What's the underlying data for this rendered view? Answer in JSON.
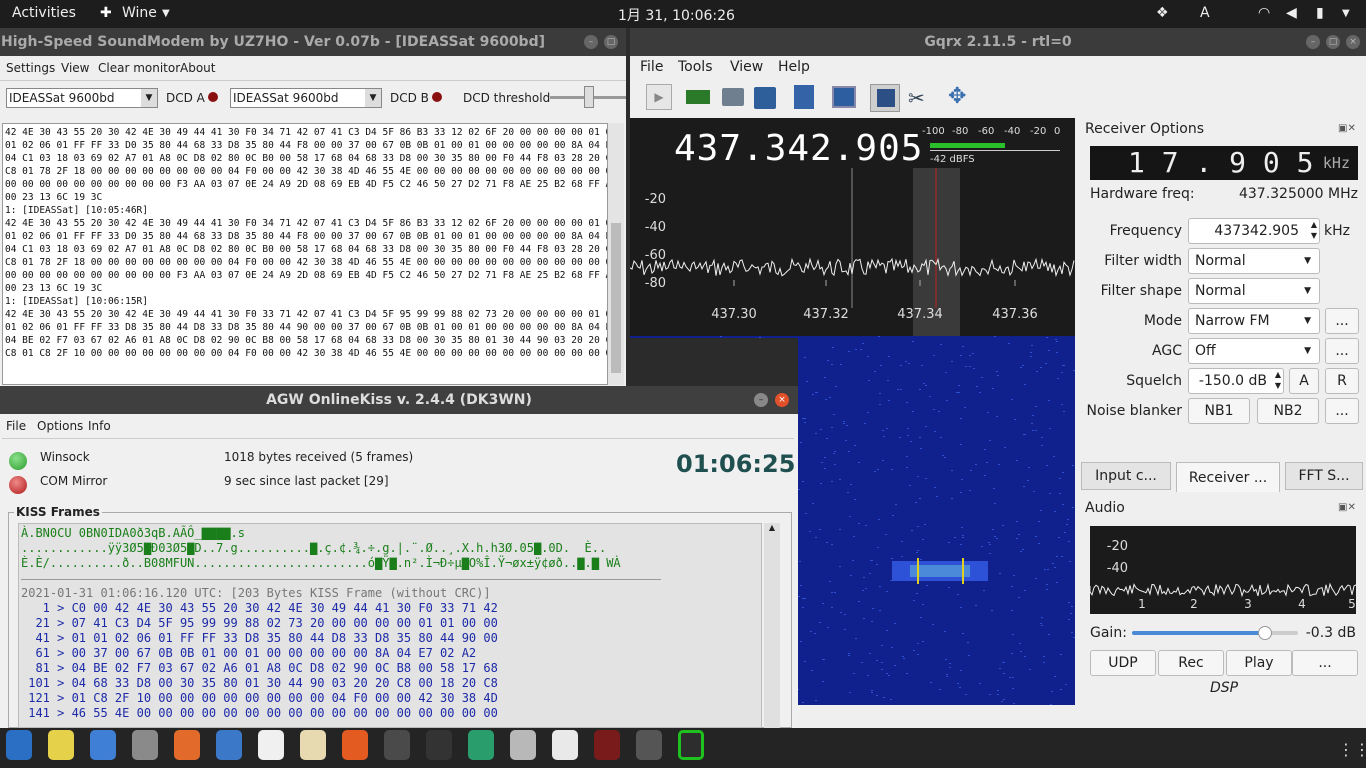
{
  "topbar": {
    "activities": "Activities",
    "app": "Wine",
    "clock": "1月 31, 10:06:26",
    "lang": "A"
  },
  "soundmodem": {
    "title": "High-Speed SoundModem by UZ7HO - Ver 0.07b - [IDEASSat 9600bd]",
    "menu": [
      "Settings",
      "View",
      "Clear monitor",
      "About"
    ],
    "mode_a": "IDEASSat 9600bd",
    "dcd_a": "DCD A",
    "mode_b": "IDEASSat 9600bd",
    "dcd_b": "DCD B",
    "dcd_threshold": "DCD threshold",
    "monitor": [
      "42 4E 30 43 55 20 30 42 4E 30 49 44 41 30 F0 34 71 42 07 41 C3 D4 5F 86 B3 33 12 02 6F 20 00 00 00 00 01 01 00 00 01",
      "01 02 06 01 FF FF 33 D0 35 80 44 68 33 D8 35 80 44 F8 00 00 37 00 67 0B 0B 01 00 01 00 00 00 00 00 8A 04 EA 02 B1",
      "04 C1 03 18 03 69 02 A7 01 A8 0C D8 02 80 0C B0 00 58 17 68 04 68 33 D8 00 30 35 80 00 F0 44 F8 03 28 20 C0 00 18 20",
      "C8 01 78 2F 18 00 00 00 00 00 00 00 00 04 F0 00 00 42 30 38 4D 46 55 4E 00 00 00 00 00 00 00 00 00 00 00 00 00 00 00",
      "00 00 00 00 00 00 00 00 00 00 F3 AA 03 07 0E 24 A9 2D 08 69 EB 4D F5 C2 46 50 27 D2 71 F8 AE 25 B2 68 FF A9 D8 F0 00",
      "00 23 13 6C 19 3C",
      "",
      "1: [IDEASSat] [10:05:46R]",
      "42 4E 30 43 55 20 30 42 4E 30 49 44 41 30 F0 34 71 42 07 41 C3 D4 5F 86 B3 33 12 02 6F 20 00 00 00 00 01 01 00 00 01",
      "01 02 06 01 FF FF 33 D0 35 80 44 68 33 D8 35 80 44 F8 00 00 37 00 67 0B 0B 01 00 01 00 00 00 00 00 8A 04 EA 02 B1",
      "04 C1 03 18 03 69 02 A7 01 A8 0C D8 02 80 0C B0 00 58 17 68 04 68 33 D8 00 30 35 80 00 F0 44 F8 03 28 20 C0 00 18 20",
      "C8 01 78 2F 18 00 00 00 00 00 00 00 00 04 F0 00 00 42 30 38 4D 46 55 4E 00 00 00 00 00 00 00 00 00 00 00 00 00 00 00",
      "00 00 00 00 00 00 00 00 00 00 F3 AA 03 07 0E 24 A9 2D 08 69 EB 4D F5 C2 46 50 27 D2 71 F8 AE 25 B2 68 FF A9 D8 F0 00",
      "00 23 13 6C 19 3C",
      "",
      "1: [IDEASSat] [10:06:15R]",
      "42 4E 30 43 55 20 30 42 4E 30 49 44 41 30 F0 33 71 42 07 41 C3 D4 5F 95 99 99 88 02 73 20 00 00 00 00 01 01 00 00 01",
      "01 02 06 01 FF FF 33 D8 35 80 44 D8 33 D8 35 80 44 90 00 00 37 00 67 0B 0B 01 00 01 00 00 00 00 00 8A 04 E7 02 A2",
      "04 BE 02 F7 03 67 02 A6 01 A8 0C D8 02 90 0C B8 00 58 17 68 04 68 33 D8 00 30 35 80 01 30 44 90 03 20 20 C8 00 18 20",
      "C8 01 C8 2F 10 00 00 00 00 00 00 00 00 04 F0 00 00 42 30 38 4D 46 55 4E 00 00 00 00 00 00 00 00 00 00 00 00 00 00 00"
    ]
  },
  "agw": {
    "title": "AGW OnlineKiss v. 2.4.4  (DK3WN)",
    "menu": [
      "File",
      "Options",
      "Info"
    ],
    "winsock": "Winsock",
    "winsock_status": "1018 bytes received (5 frames)",
    "com": "COM Mirror",
    "com_status": "9 sec since last packet [29]",
    "timer": "01:06:25",
    "kiss_title": "KISS Frames",
    "ascii": [
      "À.BN0CU 0BN0IDA0ð3qB.AÃÔ_▇▇▇▇.s",
      "............ÿÿ3Ø5▇Ð03Ø5▇D..7.g..........▇.ç.¢.¾.÷.g.|.¨.Ø..¸.X.h.h3Ø.05▇.0D.  È..",
      "È.È/..........ð..B08MFUN........................ó▇Ÿ▇.n².Ì¬Ð÷µ▇O%Î.Ÿ¬øx±ÿ¢øð..▇.▇ WÀ"
    ],
    "frame_header": "2021-01-31 01:06:16.120 UTC: [203 Bytes KISS Frame (without CRC)]",
    "hex": [
      "   1 > C0 00 42 4E 30 43 55 20 30 42 4E 30 49 44 41 30 F0 33 71 42",
      "  21 > 07 41 C3 D4 5F 95 99 99 88 02 73 20 00 00 00 00 01 01 00 00",
      "  41 > 01 01 02 06 01 FF FF 33 D8 35 80 44 D8 33 D8 35 80 44 90 00",
      "  61 > 00 37 00 67 0B 0B 01 00 01 00 00 00 00 00 8A 04 E7 02 A2",
      "  81 > 04 BE 02 F7 03 67 02 A6 01 A8 0C D8 02 90 0C B8 00 58 17 68",
      " 101 > 04 68 33 D8 00 30 35 80 01 30 44 90 03 20 20 C8 00 18 20 C8",
      " 121 > 01 C8 2F 10 00 00 00 00 00 00 00 00 04 F0 00 00 42 30 38 4D",
      " 141 > 46 55 4E 00 00 00 00 00 00 00 00 00 00 00 00 00 00 00 00 00"
    ]
  },
  "gqrx": {
    "title": "Gqrx 2.11.5 - rtl=0",
    "menu": [
      "File",
      "Tools",
      "View",
      "Help"
    ],
    "freq_display": "437.342.905",
    "meter_ticks": [
      "-100",
      "-80",
      "-60",
      "-40",
      "-20",
      "0"
    ],
    "meter_level": "-42 dBFS",
    "db_ticks": [
      "-20",
      "-40",
      "-60",
      "-80"
    ],
    "freq_ticks": [
      "437.30",
      "437.32",
      "437.34",
      "437.36"
    ],
    "receiver_title": "Receiver Options",
    "offset_display": "1 7 . 9 0 5",
    "offset_unit": "kHz",
    "hw_freq_label": "Hardware freq:",
    "hw_freq": "437.325000 MHz",
    "frequency_label": "Frequency",
    "frequency": "437342.905",
    "frequency_unit": "kHz",
    "filter_width_label": "Filter width",
    "filter_width": "Normal",
    "filter_shape_label": "Filter shape",
    "filter_shape": "Normal",
    "mode_label": "Mode",
    "mode": "Narrow FM",
    "agc_label": "AGC",
    "agc": "Off",
    "squelch_label": "Squelch",
    "squelch": "-150.0 dB",
    "sq_a": "A",
    "sq_r": "R",
    "nb_label": "Noise blanker",
    "nb1": "NB1",
    "nb2": "NB2",
    "more": "...",
    "tabs": [
      "Input c...",
      "Receiver ...",
      "FFT S..."
    ],
    "audio_title": "Audio",
    "audio_ticks": [
      "-20",
      "-40"
    ],
    "audio_freq": [
      "1",
      "2",
      "3",
      "4",
      "5"
    ],
    "gain_label": "Gain:",
    "gain_value": "-0.3 dB",
    "gain_level": 0.8,
    "audio_buttons": [
      "UDP",
      "Rec",
      "Play",
      "..."
    ],
    "dsp": "DSP"
  },
  "dock": [
    "help",
    "wine",
    "file",
    "files",
    "store",
    "thunderbird",
    "doc",
    "notes",
    "firefox",
    "terminal",
    "monitor",
    "satellite",
    "tools",
    "gpredict",
    "wine-glass",
    "drive",
    "gqrx"
  ]
}
